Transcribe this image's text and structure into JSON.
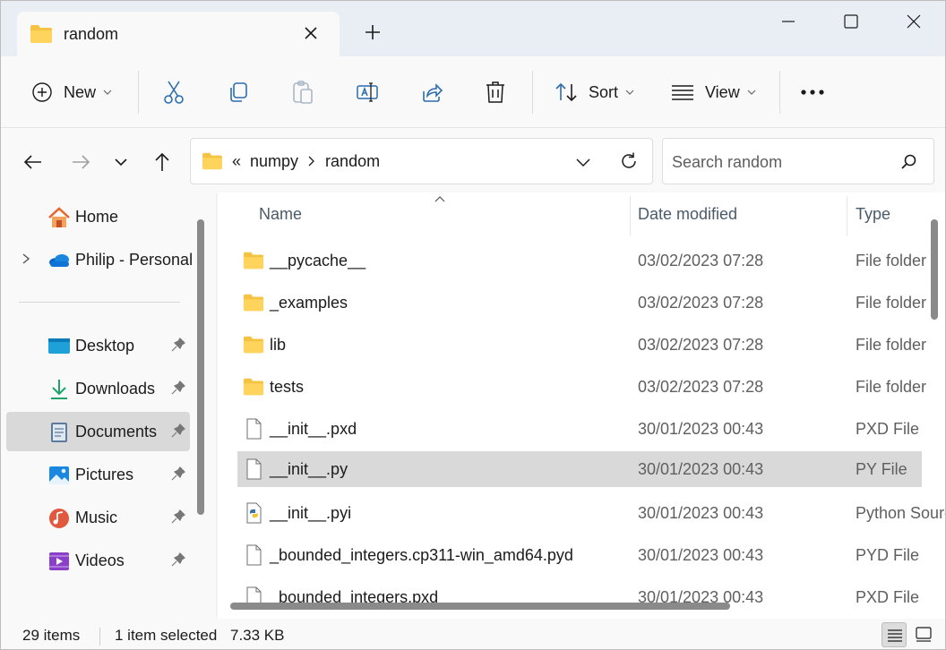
{
  "tab": {
    "title": "random",
    "folder_icon": "folder-icon",
    "close_icon": "close-icon"
  },
  "new_tab_icon": "plus-icon",
  "window_controls": [
    "minimize-icon",
    "maximize-icon",
    "close-icon"
  ],
  "toolbar": {
    "new_label": "New",
    "sort_label": "Sort",
    "view_label": "View",
    "icons": [
      "cut-icon",
      "copy-icon",
      "paste-icon",
      "rename-icon",
      "share-icon",
      "delete-icon",
      "more-icon"
    ]
  },
  "nav": {
    "path_prefix": "«",
    "breadcrumbs": [
      "numpy",
      "random"
    ],
    "search_placeholder": "Search random"
  },
  "sidebar": {
    "items": [
      {
        "label": "Home",
        "icon": "home-icon"
      },
      {
        "label": "Philip - Personal",
        "icon": "onedrive-icon"
      },
      {
        "label": "Desktop",
        "icon": "desktop-icon"
      },
      {
        "label": "Downloads",
        "icon": "downloads-icon"
      },
      {
        "label": "Documents",
        "icon": "documents-icon"
      },
      {
        "label": "Pictures",
        "icon": "pictures-icon"
      },
      {
        "label": "Music",
        "icon": "music-icon"
      },
      {
        "label": "Videos",
        "icon": "videos-icon"
      }
    ]
  },
  "columns": {
    "name": "Name",
    "date": "Date modified",
    "type": "Type"
  },
  "files": [
    {
      "name": "__pycache__",
      "date": "03/02/2023 07:28",
      "type": "File folder",
      "icon": "folder-icon"
    },
    {
      "name": "_examples",
      "date": "03/02/2023 07:28",
      "type": "File folder",
      "icon": "folder-icon"
    },
    {
      "name": "lib",
      "date": "03/02/2023 07:28",
      "type": "File folder",
      "icon": "folder-icon"
    },
    {
      "name": "tests",
      "date": "03/02/2023 07:28",
      "type": "File folder",
      "icon": "folder-icon"
    },
    {
      "name": "__init__.pxd",
      "date": "30/01/2023 00:43",
      "type": "PXD File",
      "icon": "file-icon"
    },
    {
      "name": "__init__.py",
      "date": "30/01/2023 00:43",
      "type": "PY File",
      "icon": "file-icon",
      "selected": true
    },
    {
      "name": "__init__.pyi",
      "date": "30/01/2023 00:43",
      "type": "Python Source",
      "icon": "python-file-icon"
    },
    {
      "name": "_bounded_integers.cp311-win_amd64.pyd",
      "date": "30/01/2023 00:43",
      "type": "PYD File",
      "icon": "file-icon"
    },
    {
      "name": "_bounded_integers.pxd",
      "date": "30/01/2023 00:43",
      "type": "PXD File",
      "icon": "file-icon"
    }
  ],
  "status": {
    "item_count": "29 items",
    "selection": "1 item selected",
    "size": "7.33 KB"
  }
}
